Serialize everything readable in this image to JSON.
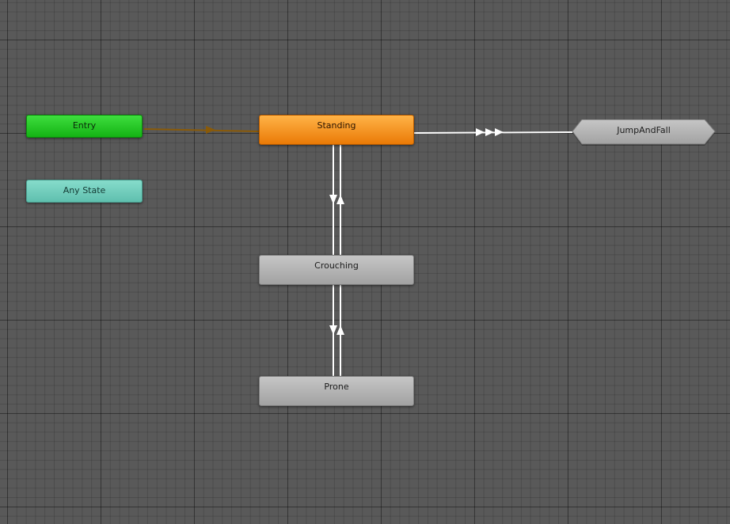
{
  "states": {
    "entry": {
      "label": "Entry"
    },
    "any_state": {
      "label": "Any State"
    },
    "standing": {
      "label": "Standing"
    },
    "crouching": {
      "label": "Crouching"
    },
    "prone": {
      "label": "Prone"
    },
    "jump_and_fall": {
      "label": "JumpAndFall"
    }
  },
  "colors": {
    "background": "#595959",
    "entry": "#22c522",
    "any_state": "#70cdbd",
    "default_state": "#f08a14",
    "state": "#b0b0b0",
    "transition": "#ffffff",
    "default_transition": "#8a5a08"
  },
  "transitions": [
    {
      "from": "Entry",
      "to": "Standing",
      "type": "default"
    },
    {
      "from": "Standing",
      "to": "JumpAndFall",
      "arrows": 3
    },
    {
      "from": "Standing",
      "to": "Crouching"
    },
    {
      "from": "Crouching",
      "to": "Standing"
    },
    {
      "from": "Crouching",
      "to": "Prone"
    },
    {
      "from": "Prone",
      "to": "Crouching"
    }
  ]
}
